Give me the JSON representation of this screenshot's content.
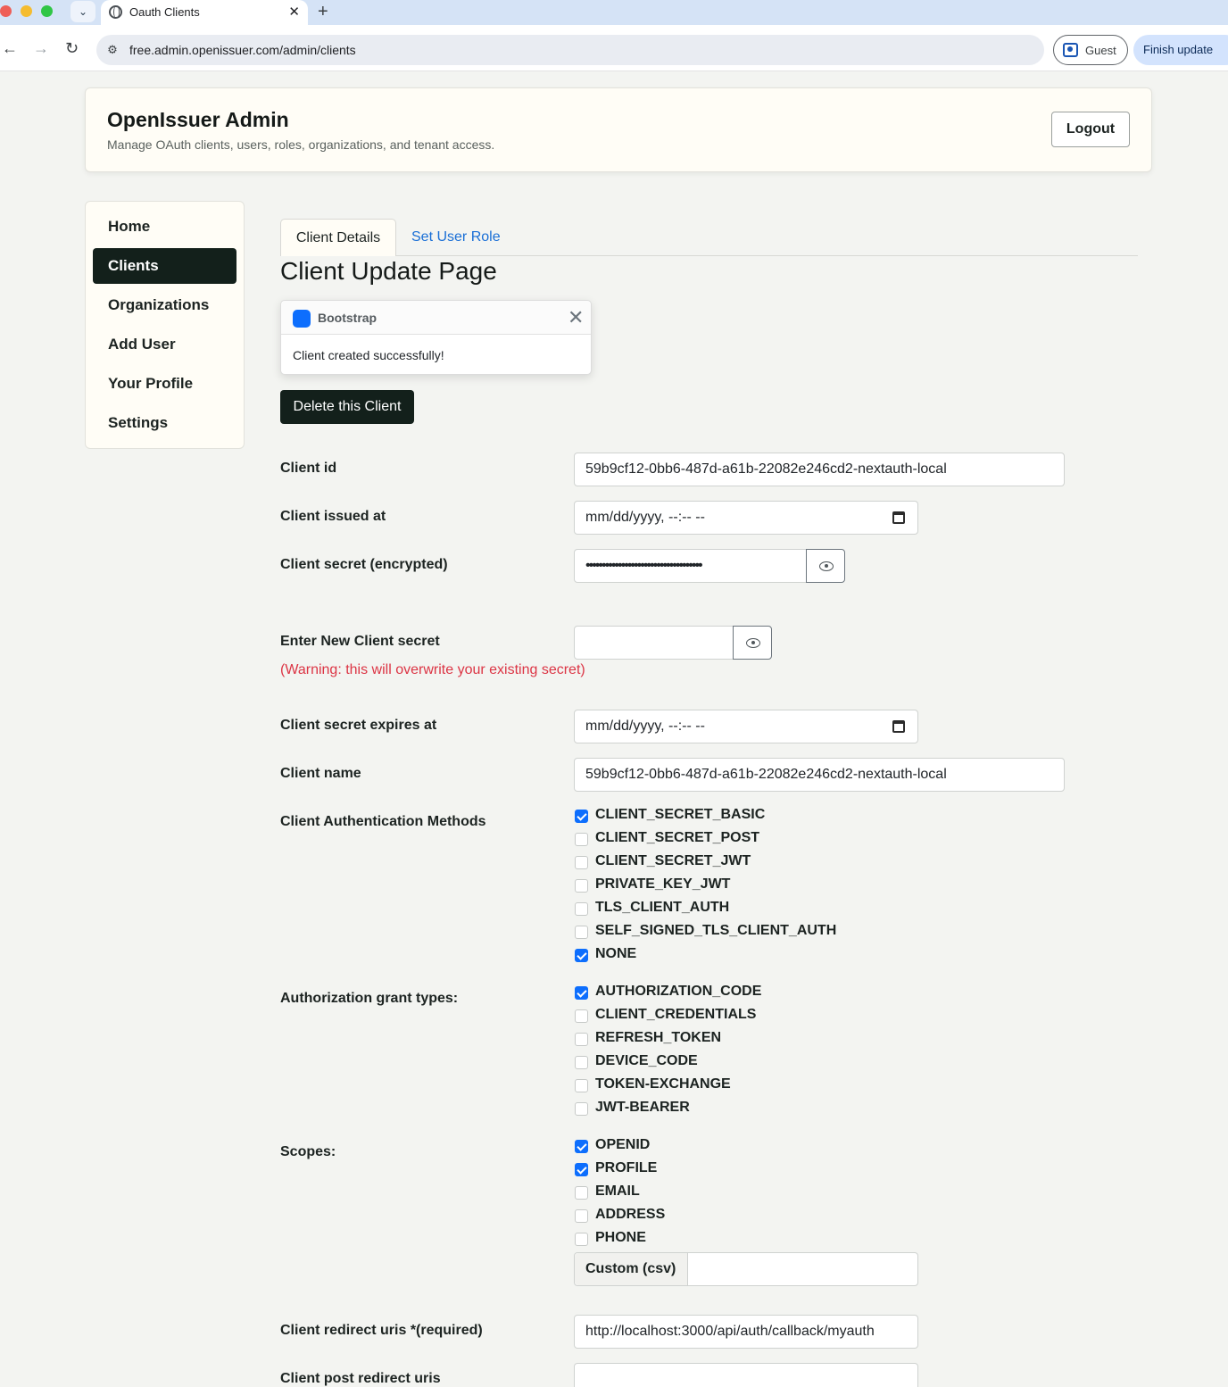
{
  "browser": {
    "tab_title": "Oauth Clients",
    "url": "free.admin.openissuer.com/admin/clients",
    "guest_label": "Guest",
    "finish_update_label": "Finish update"
  },
  "header": {
    "title": "OpenIssuer Admin",
    "subtitle": "Manage OAuth clients, users, roles, organizations, and tenant access.",
    "logout_label": "Logout"
  },
  "sidebar": {
    "items": [
      {
        "label": "Home",
        "active": false
      },
      {
        "label": "Clients",
        "active": true
      },
      {
        "label": "Organizations",
        "active": false
      },
      {
        "label": "Add User",
        "active": false
      },
      {
        "label": "Your Profile",
        "active": false
      },
      {
        "label": "Settings",
        "active": false
      }
    ]
  },
  "tabs": {
    "client_details": "Client Details",
    "set_user_role": "Set User Role"
  },
  "page_title": "Client Update Page",
  "toast": {
    "title": "Bootstrap",
    "message": "Client created successfully!"
  },
  "delete_button": "Delete this Client",
  "form": {
    "client_id_label": "Client id",
    "client_id_value": "59b9cf12-0bb6-487d-a61b-22082e246cd2-nextauth-local",
    "issued_at_label": "Client issued at",
    "issued_at_placeholder": "mm/dd/yyyy, --:-- --",
    "secret_label": "Client secret (encrypted)",
    "secret_value": "••••••••••••••••••••••••••••••••••••",
    "new_secret_label": "Enter New Client secret",
    "new_secret_warning": "(Warning: this will overwrite your existing secret)",
    "expires_label": "Client secret expires at",
    "expires_placeholder": "mm/dd/yyyy, --:-- --",
    "name_label": "Client name",
    "name_value": "59b9cf12-0bb6-487d-a61b-22082e246cd2-nextauth-local",
    "auth_methods_label": "Client Authentication Methods",
    "auth_methods": [
      {
        "label": "CLIENT_SECRET_BASIC",
        "checked": true
      },
      {
        "label": "CLIENT_SECRET_POST",
        "checked": false
      },
      {
        "label": "CLIENT_SECRET_JWT",
        "checked": false
      },
      {
        "label": "PRIVATE_KEY_JWT",
        "checked": false
      },
      {
        "label": "TLS_CLIENT_AUTH",
        "checked": false
      },
      {
        "label": "SELF_SIGNED_TLS_CLIENT_AUTH",
        "checked": false
      },
      {
        "label": "NONE",
        "checked": true
      }
    ],
    "grant_types_label": "Authorization grant types:",
    "grant_types": [
      {
        "label": "AUTHORIZATION_CODE",
        "checked": true
      },
      {
        "label": "CLIENT_CREDENTIALS",
        "checked": false
      },
      {
        "label": "REFRESH_TOKEN",
        "checked": false
      },
      {
        "label": "DEVICE_CODE",
        "checked": false
      },
      {
        "label": "TOKEN-EXCHANGE",
        "checked": false
      },
      {
        "label": "JWT-BEARER",
        "checked": false
      }
    ],
    "scopes_label": "Scopes:",
    "scopes": [
      {
        "label": "OPENID",
        "checked": true
      },
      {
        "label": "PROFILE",
        "checked": true
      },
      {
        "label": "EMAIL",
        "checked": false
      },
      {
        "label": "ADDRESS",
        "checked": false
      },
      {
        "label": "PHONE",
        "checked": false
      }
    ],
    "custom_scopes_label": "Custom (csv)",
    "redirect_label": "Client redirect uris *(required)",
    "redirect_value": "http://localhost:3000/api/auth/callback/myauth",
    "post_redirect_label": "Client post redirect uris"
  }
}
